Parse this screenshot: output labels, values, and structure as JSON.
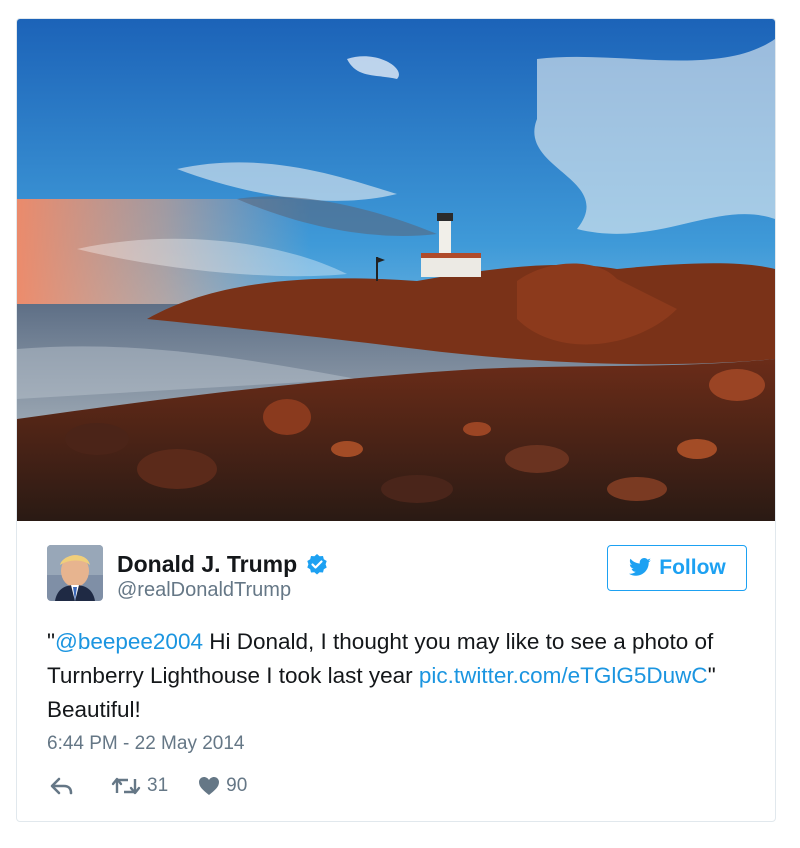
{
  "tweet": {
    "author_name": "Donald J. Trump",
    "handle": "@realDonaldTrump",
    "follow_label": "Follow",
    "text_parts": {
      "open_quote": "\"",
      "mention": "@beepee2004",
      "body": " Hi Donald, I thought you may like to see a photo of Turnberry Lighthouse I took last year ",
      "link": "pic.twitter.com/eTGlG5DuwC",
      "closing": "\" Beautiful!"
    },
    "timestamp": "6:44 PM - 22 May 2014",
    "retweet_count": "31",
    "like_count": "90"
  },
  "icons": [
    "verified-badge-icon",
    "twitter-bird-icon",
    "reply-icon",
    "retweet-icon",
    "heart-icon"
  ],
  "colors": {
    "accent": "#1da1f2",
    "link": "#1b95e0",
    "text": "#14171a",
    "muted": "#657786",
    "border": "#e1e8ed"
  }
}
